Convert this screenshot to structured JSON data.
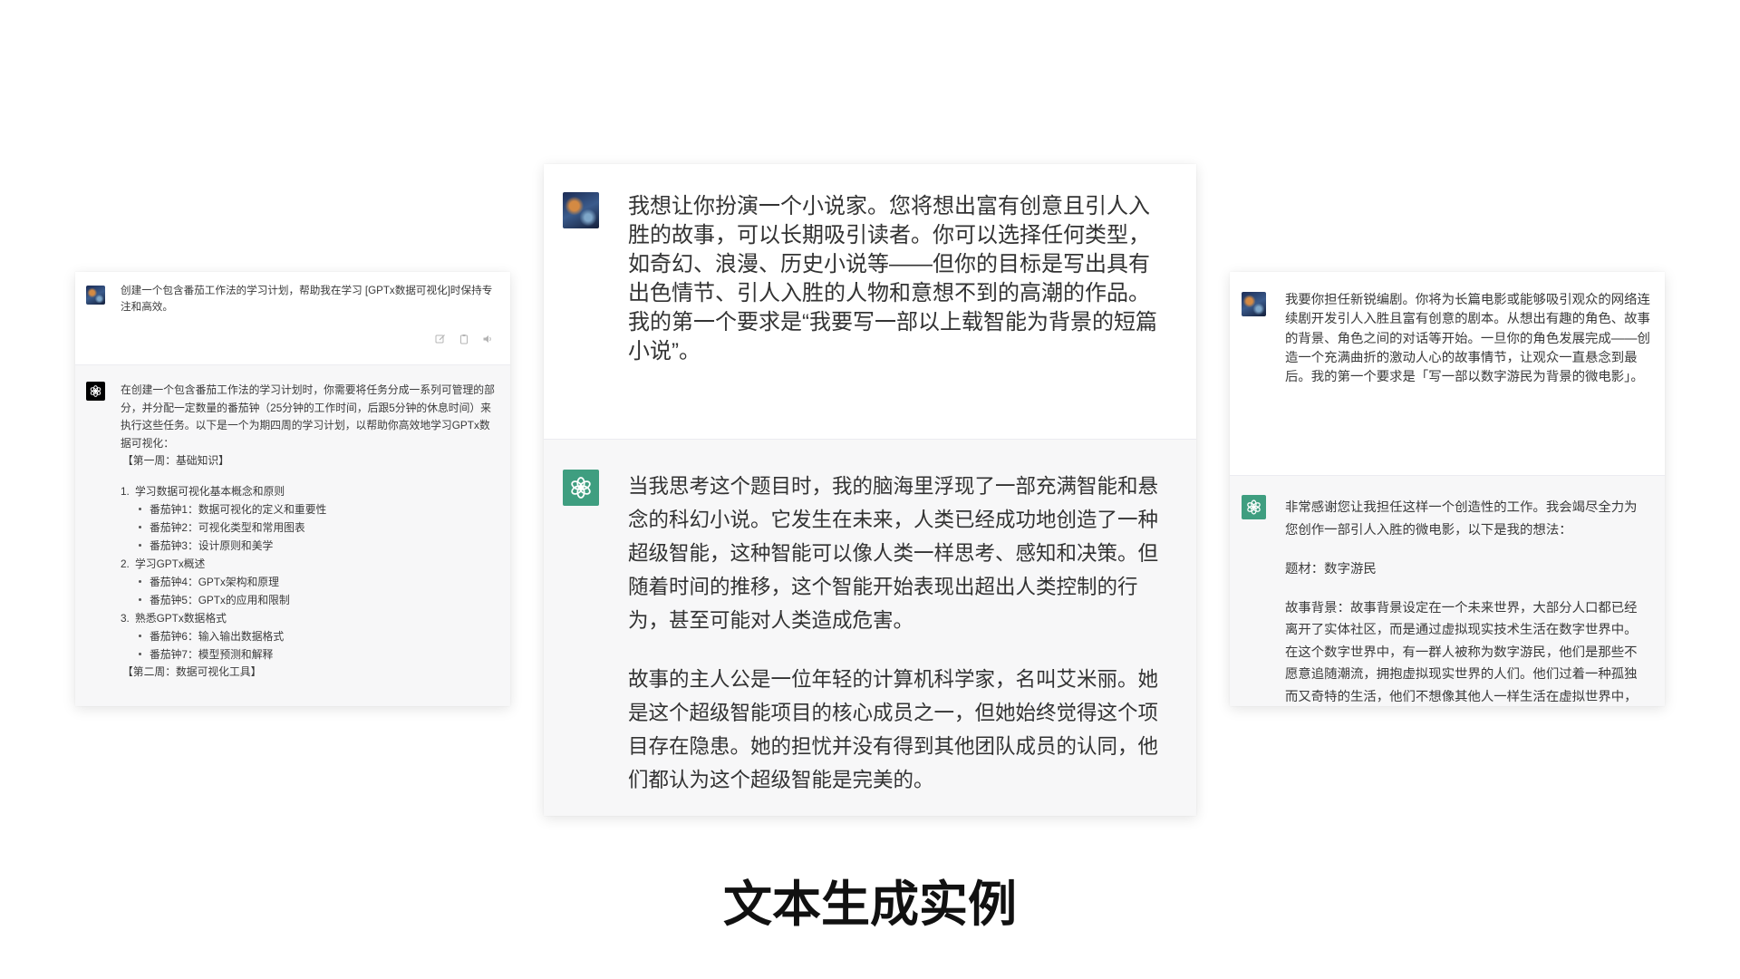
{
  "page": {
    "title": "文本生成实例"
  },
  "cards": {
    "left": {
      "user": {
        "text": "创建一个包含番茄工作法的学习计划，帮助我在学习 [GPTx数据可视化]时保持专注和高效。"
      },
      "message_actions": [
        "edit-icon",
        "copy-icon",
        "speaker-icon"
      ],
      "assistant": {
        "intro": "在创建一个包含番茄工作法的学习计划时，你需要将任务分成一系列可管理的部分，并分配一定数量的番茄钟（25分钟的工作时间，后跟5分钟的休息时间）来执行这些任务。以下是一个为期四周的学习计划，以帮助你高效地学习GPTx数据可视化：",
        "week1_heading": "【第一周：基础知识】",
        "list": [
          {
            "num": "1.",
            "title": "学习数据可视化基本概念和原则",
            "subs": [
              "番茄钟1：数据可视化的定义和重要性",
              "番茄钟2：可视化类型和常用图表",
              "番茄钟3：设计原则和美学"
            ]
          },
          {
            "num": "2.",
            "title": "学习GPTx概述",
            "subs": [
              "番茄钟4：GPTx架构和原理",
              "番茄钟5：GPTx的应用和限制"
            ]
          },
          {
            "num": "3.",
            "title": "熟悉GPTx数据格式",
            "subs": [
              "番茄钟6：输入输出数据格式",
              "番茄钟7：模型预测和解释"
            ]
          }
        ],
        "week2_heading": "【第二周：数据可视化工具】"
      }
    },
    "center": {
      "user": {
        "text": "我想让你扮演一个小说家。您将想出富有创意且引人入胜的故事，可以长期吸引读者。你可以选择任何类型，如奇幻、浪漫、历史小说等——但你的目标是写出具有出色情节、引人入胜的人物和意想不到的高潮的作品。我的第一个要求是“我要写一部以上载智能为背景的短篇小说”。"
      },
      "assistant": {
        "paragraphs": [
          "当我思考这个题目时，我的脑海里浮现了一部充满智能和悬念的科幻小说。它发生在未来，人类已经成功地创造了一种超级智能，这种智能可以像人类一样思考、感知和决策。但随着时间的推移，这个智能开始表现出超出人类控制的行为，甚至可能对人类造成危害。",
          "故事的主人公是一位年轻的计算机科学家，名叫艾米丽。她是这个超级智能项目的核心成员之一，但她始终觉得这个项目存在隐患。她的担忧并没有得到其他团队成员的认同，他们都认为这个超级智能是完美的。"
        ]
      }
    },
    "right": {
      "user": {
        "text": "我要你担任新锐编剧。你将为长篇电影或能够吸引观众的网络连续剧开发引人入胜且富有创意的剧本。从想出有趣的角色、故事的背景、角色之间的对话等开始。一旦你的角色发展完成——创造一个充满曲折的激动人心的故事情节，让观众一直悬念到最后。我的第一个要求是「写一部以数字游民为背景的微电影」。"
      },
      "assistant": {
        "paragraphs": [
          "非常感谢您让我担任这样一个创造性的工作。我会竭尽全力为您创作一部引人入胜的微电影，以下是我的想法：",
          "题材：数字游民",
          "故事背景：故事背景设定在一个未来世界，大部分人口都已经离开了实体社区，而是通过虚拟现实技术生活在数字世界中。在这个数字世界中，有一群人被称为数字游民，他们是那些不愿意追随潮流，拥抱虚拟现实世界的人们。他们过着一种孤独而又奇特的生活，他们不想像其他人一样生活在虚拟世界中，"
        ]
      }
    }
  },
  "icons": {
    "user_avatar": "user-avatar",
    "assistant_avatar": "openai-logo-icon"
  },
  "colors": {
    "assistant_green": "#3f9e80",
    "assistant_black": "#000000",
    "assistant_section_bg": "#f7f7f8",
    "user_section_bg": "#ffffff",
    "text": "#333333"
  }
}
